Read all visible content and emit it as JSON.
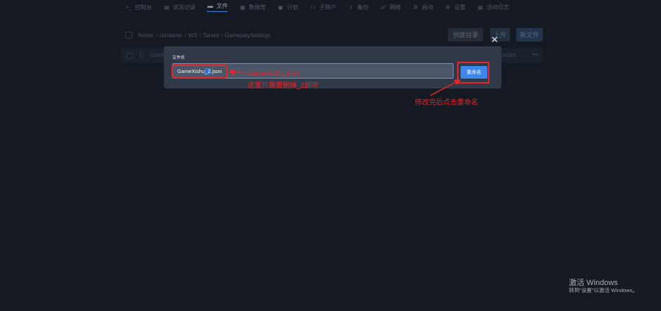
{
  "nav": {
    "items": [
      {
        "icon": ">_",
        "label": "控制台"
      },
      {
        "icon": "▤",
        "label": "状态记录"
      },
      {
        "icon": "▬",
        "label": "文件",
        "active": true
      },
      {
        "icon": "▦",
        "label": "数据库"
      },
      {
        "icon": "▣",
        "label": "计划"
      },
      {
        "icon": "⚇",
        "label": "子用户"
      },
      {
        "icon": "⇪",
        "label": "备份"
      },
      {
        "icon": "☍",
        "label": "网络"
      },
      {
        "icon": "✲",
        "label": "启动"
      },
      {
        "icon": "✲",
        "label": "设置"
      },
      {
        "icon": "▤",
        "label": "活动日志"
      }
    ]
  },
  "breadcrumb": [
    "/home",
    "container",
    "WS",
    "Saved",
    "GameplaySettings"
  ],
  "toolbar": {
    "mkdir_label": "创建目录",
    "upload_label": "上传",
    "newfile_label": "新文件"
  },
  "file_row": {
    "name": "Game",
    "time": "nutes",
    "more": "•••"
  },
  "modal": {
    "label": "文件名",
    "close": "✕",
    "filename_before": "GameXishu",
    "filename_selected": "_2",
    "filename_after": ".json",
    "rename_label": "重命名"
  },
  "annotations": {
    "line1": "GameXishu.json",
    "line2": "这里只需要删掉_2即可",
    "line3": "修改完后点击重命名"
  },
  "watermark": {
    "title": "激活 Windows",
    "subtitle": "转到\"设置\"以激活 Windows。"
  }
}
